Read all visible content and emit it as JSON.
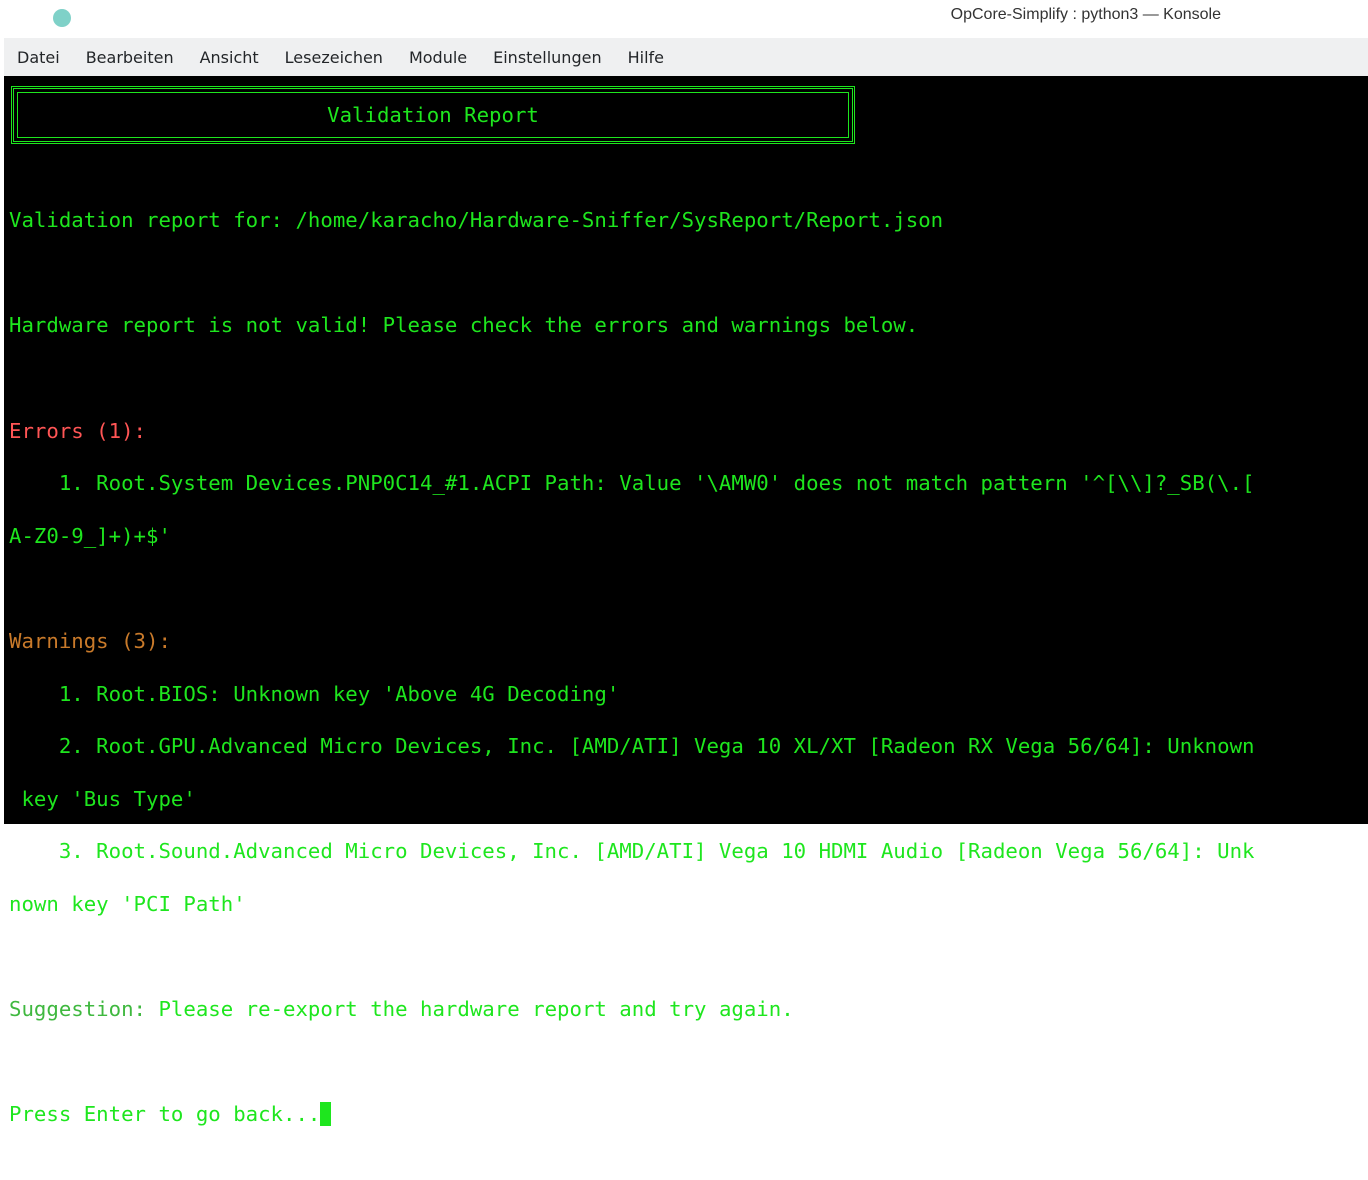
{
  "window": {
    "title": "OpCore-Simplify : python3 — Konsole"
  },
  "menu": [
    "Datei",
    "Bearbeiten",
    "Ansicht",
    "Lesezeichen",
    "Module",
    "Einstellungen",
    "Hilfe"
  ],
  "terminal": {
    "header": "Validation Report",
    "report_for": "Validation report for: /home/karacho/Hardware-Sniffer/SysReport/Report.json",
    "invalid": "Hardware report is not valid! Please check the errors and warnings below.",
    "errors_label": "Errors (1):",
    "errors": [
      "    1. Root.System Devices.PNP0C14_#1.ACPI Path: Value '\\AMW0' does not match pattern '^[\\\\]?_SB(\\.[",
      "A-Z0-9_]+)+$'"
    ],
    "warnings_label": "Warnings (3):",
    "warnings": [
      "    1. Root.BIOS: Unknown key 'Above 4G Decoding'",
      "    2. Root.GPU.Advanced Micro Devices, Inc. [AMD/ATI] Vega 10 XL/XT [Radeon RX Vega 56/64]: Unknown",
      " key 'Bus Type'",
      "    3. Root.Sound.Advanced Micro Devices, Inc. [AMD/ATI] Vega 10 HDMI Audio [Radeon Vega 56/64]: Unk",
      "nown key 'PCI Path'"
    ],
    "suggestion_label": "Suggestion:",
    "suggestion": " Please re-export the hardware report and try again.",
    "prompt": "Press Enter to go back..."
  }
}
